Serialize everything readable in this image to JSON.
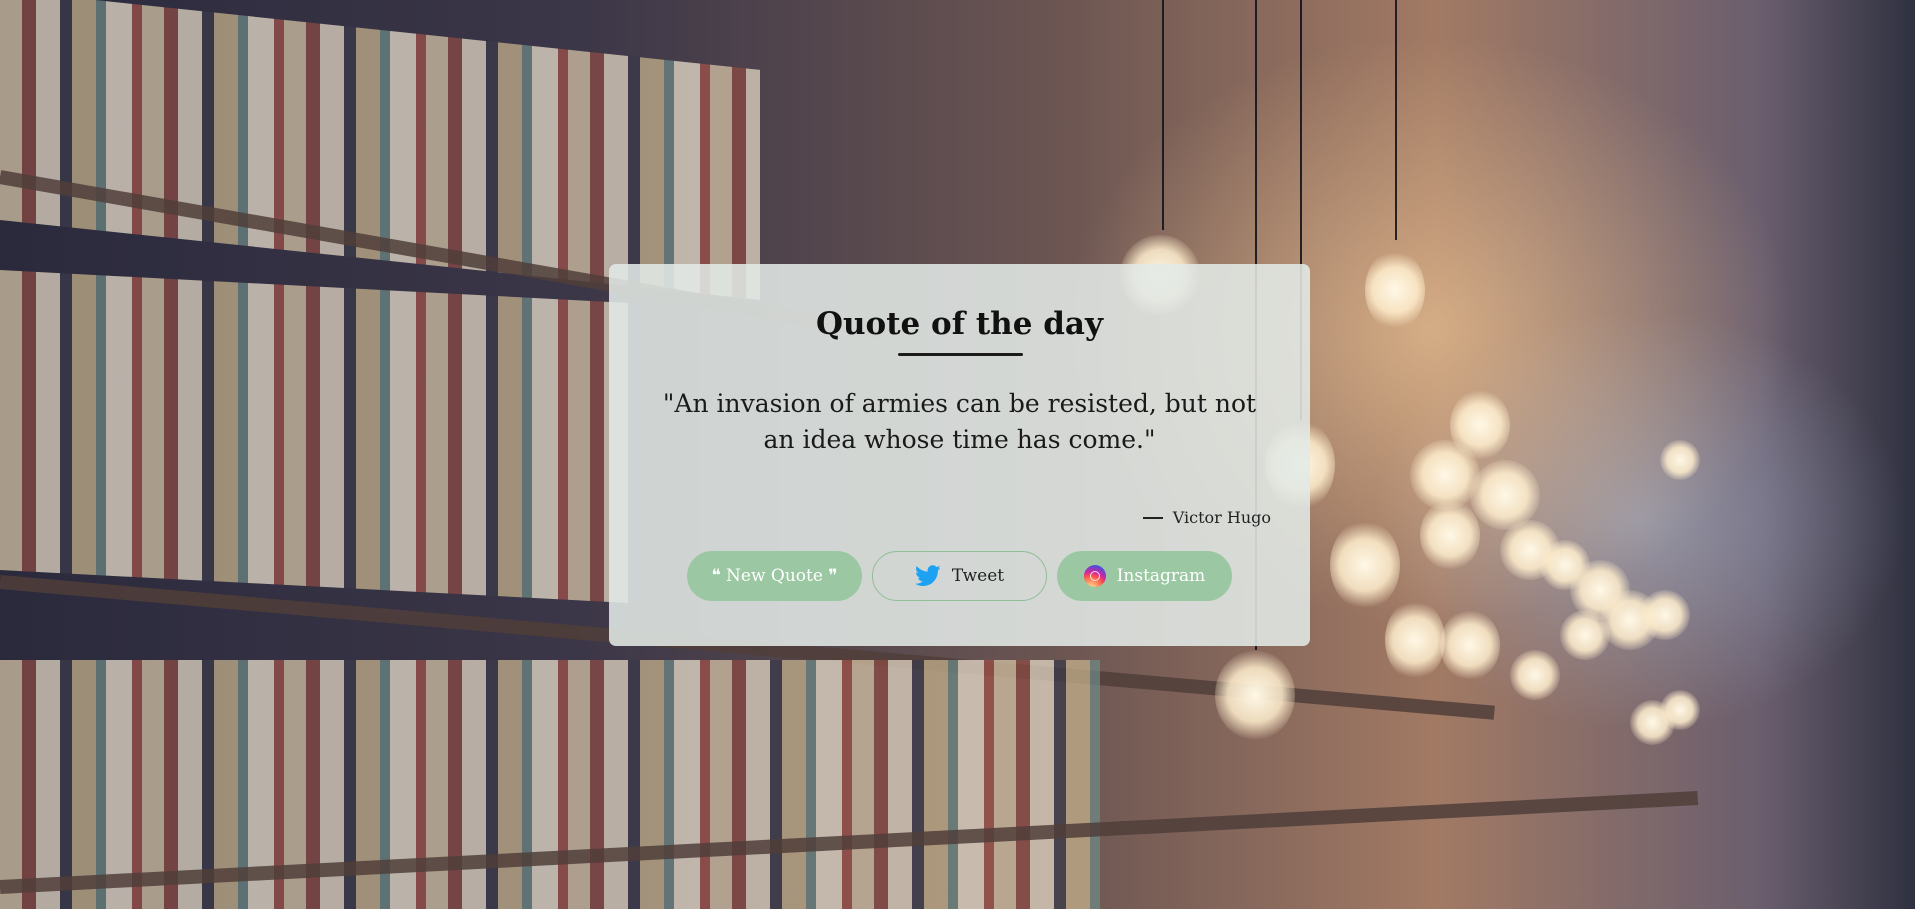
{
  "card": {
    "title": "Quote of the day",
    "quote": "\"An invasion of armies can be resisted, but not an idea whose time has come.\"",
    "author": "Victor Hugo"
  },
  "buttons": {
    "new_quote": "❝ New Quote ❞",
    "tweet": "Tweet",
    "instagram": "Instagram"
  },
  "icons": {
    "tweet": "twitter-bird-icon",
    "instagram": "instagram-icon"
  },
  "colors": {
    "accent_green": "#9bc8a3",
    "twitter_blue": "#1da1f2",
    "card_bg": "#e2e9e6"
  }
}
